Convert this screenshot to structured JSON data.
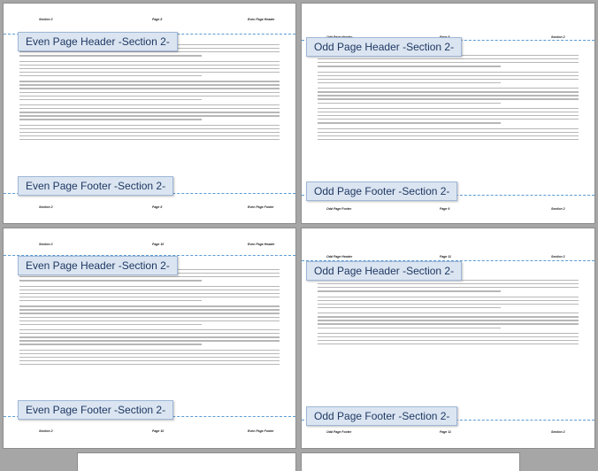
{
  "pages": [
    {
      "header_tag": "Even Page Header -Section 2-",
      "footer_tag": "Even Page Footer -Section 2-",
      "top_left": "Section 2",
      "top_mid": "Page 8",
      "top_right": "Even Page Header",
      "bottom_left": "Section 2",
      "bottom_mid": "Page 8",
      "bottom_right": "Even Page Footer"
    },
    {
      "header_tag": "Odd Page Header -Section 2-",
      "footer_tag": "Odd Page Footer -Section 2-",
      "top_left": "Odd Page Header",
      "top_mid": "Page 9",
      "top_right": "Section 2",
      "bottom_left": "Odd Page Footer",
      "bottom_mid": "Page 9",
      "bottom_right": "Section 2"
    },
    {
      "header_tag": "Even Page Header -Section 2-",
      "footer_tag": "Even Page Footer -Section 2-",
      "top_left": "Section 2",
      "top_mid": "Page 10",
      "top_right": "Even Page Header",
      "bottom_left": "Section 2",
      "bottom_mid": "Page 10",
      "bottom_right": "Even Page Footer"
    },
    {
      "header_tag": "Odd Page Header -Section 2-",
      "footer_tag": "Odd Page Footer -Section 2-",
      "top_left": "Odd Page Header",
      "top_mid": "Page 11",
      "top_right": "Section 2",
      "bottom_left": "Odd Page Footer",
      "bottom_mid": "Page 11",
      "bottom_right": "Section 2"
    }
  ]
}
